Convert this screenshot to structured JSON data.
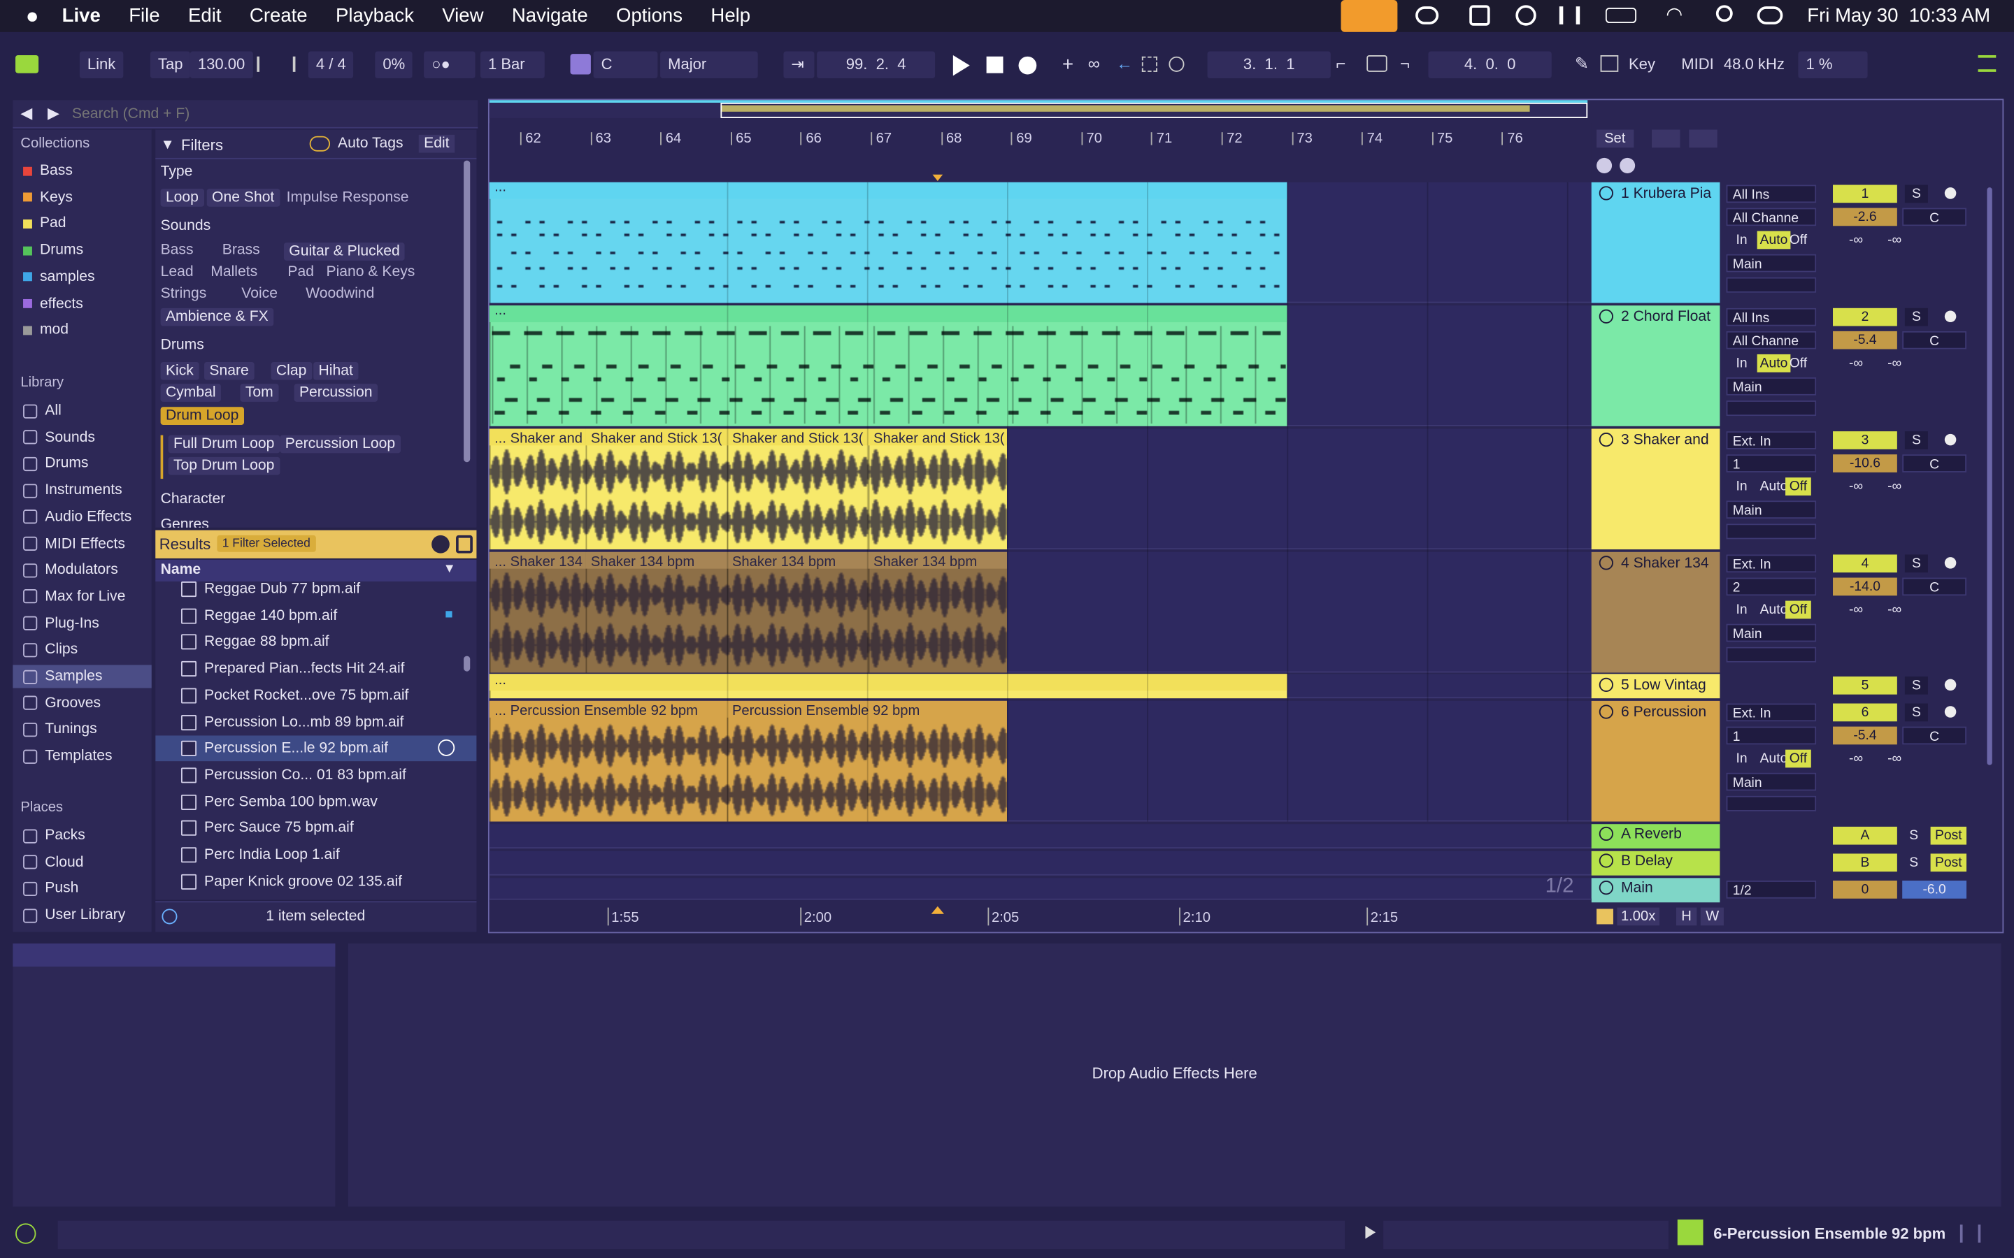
{
  "menubar": {
    "app": "Live",
    "items": [
      "File",
      "Edit",
      "Create",
      "Playback",
      "View",
      "Navigate",
      "Options",
      "Help"
    ],
    "clock": "Fri May 30  10:33 AM"
  },
  "transport": {
    "link": "Link",
    "tap": "Tap",
    "tempo": "130.00",
    "signature": "4 / 4",
    "groove": "0%",
    "quantize": "1 Bar",
    "key": "C",
    "scale": "Major",
    "position": "99.  2.  4",
    "loop_start": "3.  1.  1",
    "loop_length": "4.  0.  0",
    "key_label": "Key",
    "midi_label": "MIDI",
    "sample_rate": "48.0 kHz",
    "cpu": "1 %"
  },
  "browser": {
    "search_placeholder": "Search (Cmd + F)",
    "collections_title": "Collections",
    "collections": [
      {
        "label": "Bass",
        "color": "#e8453c"
      },
      {
        "label": "Keys",
        "color": "#ef9b35"
      },
      {
        "label": "Pad",
        "color": "#f2e05a"
      },
      {
        "label": "Drums",
        "color": "#55c45b"
      },
      {
        "label": "samples",
        "color": "#3fa7e8"
      },
      {
        "label": "effects",
        "color": "#9b6bdf"
      },
      {
        "label": "mod",
        "color": "#9a9a9a"
      }
    ],
    "library_title": "Library",
    "library": [
      "All",
      "Sounds",
      "Drums",
      "Instruments",
      "Audio Effects",
      "MIDI Effects",
      "Modulators",
      "Max for Live",
      "Plug-Ins",
      "Clips",
      "Samples",
      "Grooves",
      "Tunings",
      "Templates"
    ],
    "places_title": "Places",
    "places": [
      "Packs",
      "Cloud",
      "Push",
      "User Library"
    ]
  },
  "filters": {
    "title": "Filters",
    "auto_tags": "Auto Tags",
    "edit": "Edit",
    "type_label": "Type",
    "types": [
      "Loop",
      "One Shot",
      "Impulse Response"
    ],
    "sounds_label": "Sounds",
    "sounds": [
      "Bass",
      "Brass",
      "Guitar & Plucked",
      "Lead",
      "Mallets",
      "Pad",
      "Piano & Keys",
      "Strings",
      "Voice",
      "Woodwind",
      "Ambience & FX"
    ],
    "drums_label": "Drums",
    "drums": [
      "Kick",
      "Snare",
      "Clap",
      "Hihat",
      "Cymbal",
      "Tom",
      "Percussion",
      "Drum Loop"
    ],
    "drumloop_sub": [
      "Full Drum Loop",
      "Percussion Loop",
      "Top Drum Loop"
    ],
    "character_label": "Character",
    "genres_label": "Genres"
  },
  "results": {
    "title": "Results",
    "badge": "1 Filter Selected",
    "col_name": "Name",
    "footer": "1 item selected",
    "items": [
      "Reggae Dub 77 bpm.aif",
      "Reggae 140 bpm.aif",
      "Reggae 88 bpm.aif",
      "Prepared Pian...fects Hit 24.aif",
      "Pocket Rocket...ove 75 bpm.aif",
      "Percussion Lo...mb 89 bpm.aif",
      "Percussion E...le 92 bpm.aif",
      "Percussion Co... 01 83 bpm.aif",
      "Perc Semba 100 bpm.wav",
      "Perc Sauce 75 bpm.aif",
      "Perc India Loop 1.aif",
      "Paper Knick groove 02 135.aif"
    ]
  },
  "arrangement": {
    "bars": [
      "62",
      "63",
      "64",
      "65",
      "66",
      "67",
      "68",
      "69",
      "70",
      "71",
      "72",
      "73",
      "74",
      "75",
      "76"
    ],
    "times": [
      "1:55",
      "2:00",
      "2:05",
      "2:10",
      "2:15"
    ],
    "set": "Set",
    "zoom": "1.00x",
    "h": "H",
    "w": "W",
    "page": "1/2",
    "tracks": [
      {
        "name": "1 Krubera Pia",
        "color": "#5fd5f0",
        "input": "All Ins",
        "channel": "All Channe",
        "monitor": [
          "In",
          "Auto",
          "Off"
        ],
        "out": "Main",
        "num": "1",
        "vol": "-2.6",
        "pan": "C",
        "s": "S"
      },
      {
        "name": "2 Chord Float",
        "color": "#7be9a7",
        "input": "All Ins",
        "channel": "All Channe",
        "monitor": [
          "In",
          "Auto",
          "Off"
        ],
        "out": "Main",
        "num": "2",
        "vol": "-5.4",
        "pan": "C",
        "s": "S"
      },
      {
        "name": "3 Shaker and",
        "color": "#f7e96b",
        "input": "Ext. In",
        "channel": "1",
        "monitor": [
          "In",
          "Auto",
          "Off"
        ],
        "out": "Main",
        "num": "3",
        "vol": "-10.6",
        "pan": "C",
        "s": "S"
      },
      {
        "name": "4 Shaker 134",
        "color": "#a78555",
        "input": "Ext. In",
        "channel": "2",
        "monitor": [
          "In",
          "Auto",
          "Off"
        ],
        "out": "Main",
        "num": "4",
        "vol": "-14.0",
        "pan": "C",
        "s": "S"
      },
      {
        "name": "5 Low Vintag",
        "color": "#f7e96b",
        "num": "5",
        "s": "S"
      },
      {
        "name": "6 Percussion",
        "color": "#d6a44a",
        "input": "Ext. In",
        "channel": "1",
        "monitor": [
          "In",
          "Auto",
          "Off"
        ],
        "out": "Main",
        "num": "6",
        "vol": "-5.4",
        "pan": "C",
        "s": "S"
      }
    ],
    "returns": [
      {
        "name": "A Reverb",
        "letter": "A",
        "post": "Post"
      },
      {
        "name": "B Delay",
        "letter": "B",
        "post": "Post"
      }
    ],
    "main": {
      "name": "Main",
      "out": "1/2",
      "num": "0",
      "vol": "-6.0"
    },
    "clips": {
      "shaker": [
        "... Shaker and",
        "Shaker and Stick 13(",
        "Shaker and Stick 13(",
        "Shaker and Stick 13("
      ],
      "shaker134": [
        "... Shaker 134",
        "Shaker 134 bpm",
        "Shaker 134 bpm",
        "Shaker 134 bpm"
      ],
      "perc": [
        "... Percussion Ensemble 92 bpm",
        "Percussion Ensemble 92 bpm"
      ],
      "dots": "..."
    }
  },
  "detail": {
    "drop": "Drop Audio Effects Here"
  },
  "status": {
    "clip": "6-Percussion Ensemble 92 bpm"
  }
}
